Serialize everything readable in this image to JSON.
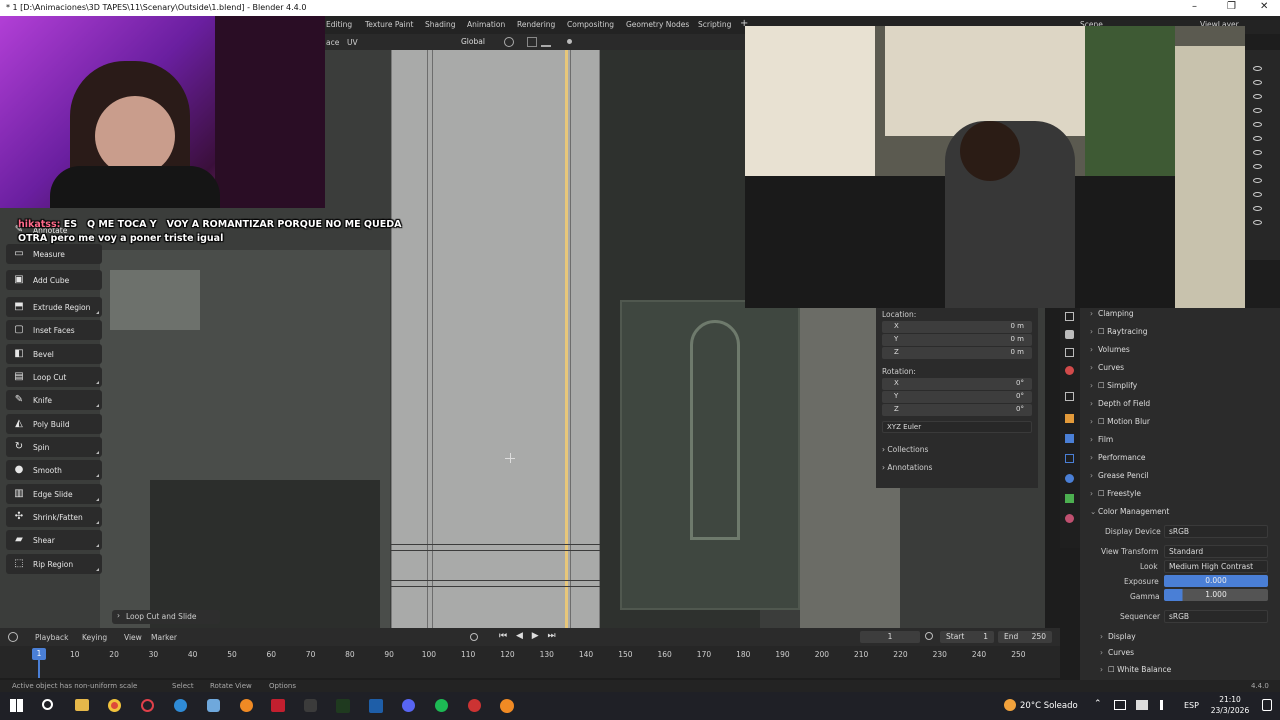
{
  "window": {
    "title": "* 1 [D:\\Animaciones\\3D TAPES\\11\\Scenary\\Outside\\1.blend] - Blender 4.4.0",
    "minimize_glyph": "–",
    "maximize_glyph": "❐",
    "close_glyph": "✕"
  },
  "topbar": {
    "tabs": [
      "Editing",
      "Texture Paint",
      "Shading",
      "Animation",
      "Rendering",
      "Compositing",
      "Geometry Nodes",
      "Scripting"
    ],
    "add_tab_glyph": "+",
    "scene_label": "Scene",
    "view_layer_label": "ViewLayer"
  },
  "viewport_header": {
    "face_label": "ace",
    "uv_label": "UV",
    "transform_orientation": "Global"
  },
  "chat": {
    "username": "hikatss:",
    "message_line1": "ES   Q ME TOCA Y   VOY A ROMANTIZAR PORQUE NO ME QUEDA",
    "message_line2": "OTRA pero me voy a poner triste igual"
  },
  "toolbar": {
    "annotate_label": "Annotate",
    "tools": [
      {
        "label": "Measure",
        "icon": "measure-icon",
        "glyph": "▭"
      },
      {
        "label": "Add Cube",
        "icon": "add-cube-icon",
        "glyph": "▣"
      },
      {
        "label": "Extrude Region",
        "icon": "extrude-region-icon",
        "glyph": "⬒"
      },
      {
        "label": "Inset Faces",
        "icon": "inset-faces-icon",
        "glyph": "▢"
      },
      {
        "label": "Bevel",
        "icon": "bevel-icon",
        "glyph": "◧"
      },
      {
        "label": "Loop Cut",
        "icon": "loop-cut-icon",
        "glyph": "▤"
      },
      {
        "label": "Knife",
        "icon": "knife-icon",
        "glyph": "✎"
      },
      {
        "label": "Poly Build",
        "icon": "poly-build-icon",
        "glyph": "◭"
      },
      {
        "label": "Spin",
        "icon": "spin-icon",
        "glyph": "↻"
      },
      {
        "label": "Smooth",
        "icon": "smooth-icon",
        "glyph": "●"
      },
      {
        "label": "Edge Slide",
        "icon": "edge-slide-icon",
        "glyph": "▥"
      },
      {
        "label": "Shrink/Fatten",
        "icon": "shrink-fatten-icon",
        "glyph": "✣"
      },
      {
        "label": "Shear",
        "icon": "shear-icon",
        "glyph": "▰"
      },
      {
        "label": "Rip Region",
        "icon": "rip-region-icon",
        "glyph": "⬚"
      }
    ]
  },
  "last_operator": {
    "label": "Loop Cut and Slide",
    "arrow_glyph": "›"
  },
  "n_panel": {
    "location_label": "Location:",
    "location": [
      {
        "axis": "X",
        "value": "0 m"
      },
      {
        "axis": "Y",
        "value": "0 m"
      },
      {
        "axis": "Z",
        "value": "0 m"
      }
    ],
    "rotation_label": "Rotation:",
    "rotation": [
      {
        "axis": "X",
        "value": "0°"
      },
      {
        "axis": "Y",
        "value": "0°"
      },
      {
        "axis": "Z",
        "value": "0°"
      }
    ],
    "rotation_mode": "XYZ Euler",
    "collections_label": "Collections",
    "annotations_label": "Annotations"
  },
  "properties": {
    "sections_top": [
      {
        "label": "Clamping",
        "checkbox": false
      },
      {
        "label": "Raytracing",
        "checkbox": true
      },
      {
        "label": "Volumes",
        "checkbox": false
      },
      {
        "label": "Curves",
        "checkbox": false
      },
      {
        "label": "Simplify",
        "checkbox": true
      },
      {
        "label": "Depth of Field",
        "checkbox": false
      },
      {
        "label": "Motion Blur",
        "checkbox": true
      },
      {
        "label": "Film",
        "checkbox": false
      },
      {
        "label": "Performance",
        "checkbox": false
      },
      {
        "label": "Grease Pencil",
        "checkbox": false
      },
      {
        "label": "Freestyle",
        "checkbox": true
      }
    ],
    "color_management_label": "Color Management",
    "display_device_label": "Display Device",
    "display_device_value": "sRGB",
    "view_transform_label": "View Transform",
    "view_transform_value": "Standard",
    "look_label": "Look",
    "look_value": "Medium High Contrast",
    "exposure_label": "Exposure",
    "exposure_value": "0.000",
    "gamma_label": "Gamma",
    "gamma_value": "1.000",
    "sequencer_label": "Sequencer",
    "sequencer_value": "sRGB",
    "sub_sections": [
      "Display",
      "Curves",
      "White Balance"
    ]
  },
  "timeline": {
    "playback_label": "Playback",
    "keying_label": "Keying",
    "view_label": "View",
    "marker_label": "Marker",
    "current_frame": "1",
    "start_label": "Start",
    "start_value": "1",
    "end_label": "End",
    "end_value": "250",
    "playhead_frame": "1",
    "ticks": [
      "10",
      "20",
      "30",
      "40",
      "50",
      "60",
      "70",
      "80",
      "90",
      "100",
      "110",
      "120",
      "130",
      "140",
      "150",
      "160",
      "170",
      "180",
      "190",
      "200",
      "210",
      "220",
      "230",
      "240",
      "250"
    ]
  },
  "statusbar": {
    "warning": "Active object has non-uniform scale",
    "select": "Select",
    "rotate_view": "Rotate View",
    "options": "Options",
    "version": "4.4.0"
  },
  "taskbar": {
    "weather": "20°C Soleado",
    "language": "ESP",
    "time": "21:10",
    "date": "23/3/2026"
  },
  "colors": {
    "accent_blue": "#4a7fd6",
    "yellow_edge": "#e8c77a"
  }
}
